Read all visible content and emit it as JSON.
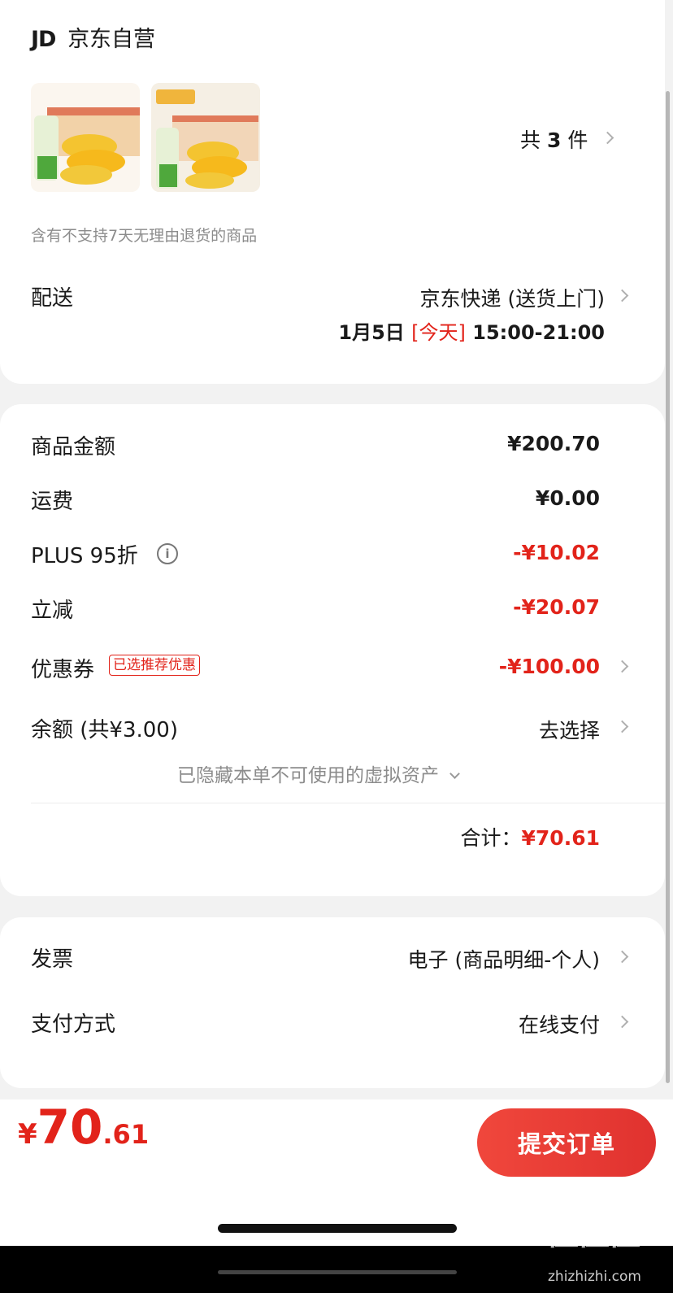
{
  "shop": {
    "logo_text": "JD",
    "name": "京东自营"
  },
  "products": {
    "count_prefix": "共",
    "count": "3",
    "count_suffix": "件"
  },
  "return_notice": "含有不支持7天无理由退货的商品",
  "delivery": {
    "label": "配送",
    "method": "京东快递 (送货上门)",
    "date": "1月5日",
    "today_tag": "[今天]",
    "time": "15:00-21:00"
  },
  "price": {
    "goods_label": "商品金额",
    "goods_value": "¥200.70",
    "shipping_label": "运费",
    "shipping_value": "¥0.00",
    "plus_label": "PLUS 95折",
    "plus_value": "-¥10.02",
    "instant_label": "立减",
    "instant_value": "-¥20.07",
    "coupon_label": "优惠券",
    "coupon_tag": "已选推荐优惠",
    "coupon_value": "-¥100.00",
    "balance_label": "余额 (共¥3.00)",
    "balance_value": "去选择",
    "hidden_assets": "已隐藏本单不可使用的虚拟资产",
    "total_label": "合计：",
    "total_value": "¥70.61"
  },
  "invoice": {
    "label": "发票",
    "value": "电子 (商品明细-个人)"
  },
  "payment": {
    "label": "支付方式",
    "value": "在线支付"
  },
  "footer": {
    "currency": "¥",
    "amount_int": "70",
    "amount_dec": ".61",
    "submit_label": "提交订单"
  },
  "watermark": {
    "text": "值值值",
    "url": "zhizhizhi.com"
  },
  "colors": {
    "accent": "#e2231a",
    "button": "#e8392f"
  }
}
